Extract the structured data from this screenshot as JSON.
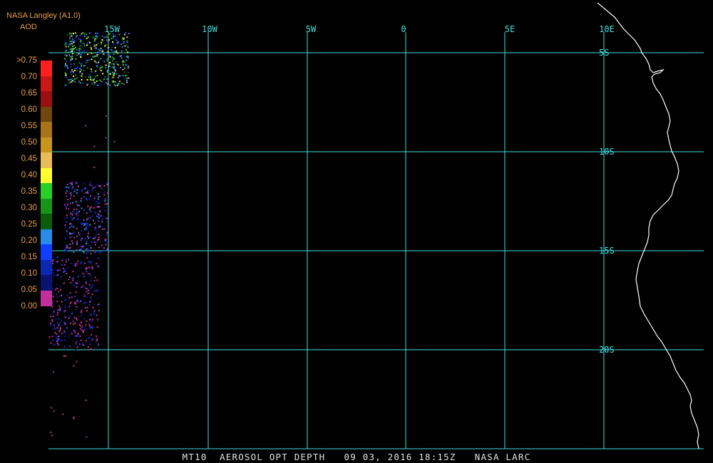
{
  "header": {
    "source": "NASA Langley (A1.0)",
    "product": "AOD"
  },
  "legend": {
    "labels": [
      ">0.75",
      "0.70",
      "0.65",
      "0.60",
      "0.55",
      "0.50",
      "0.45",
      "0.40",
      "0.35",
      "0.30",
      "0.25",
      "0.20",
      "0.15",
      "0.10",
      "0.05",
      "0.00"
    ],
    "colors": [
      "#ff2020",
      "#c81818",
      "#981010",
      "#6e4810",
      "#a8741a",
      "#c89420",
      "#e8bc58",
      "#ffff30",
      "#28d028",
      "#189418",
      "#0c5c0c",
      "#2a8ce8",
      "#1040ff",
      "#0c28b0",
      "#081470",
      "#c0309a"
    ]
  },
  "map": {
    "lon_labels": [
      "15W",
      "10W",
      "5W",
      "0",
      "5E",
      "10E"
    ],
    "lat_labels": [
      "5S",
      "10S",
      "15S",
      "20S"
    ],
    "grid_color": "#40e0e0",
    "coast_color": "#ffffff"
  },
  "footer": {
    "text": "MT10  AEROSOL OPT DEPTH   09 03, 2016 18:15Z   NASA LARC"
  }
}
